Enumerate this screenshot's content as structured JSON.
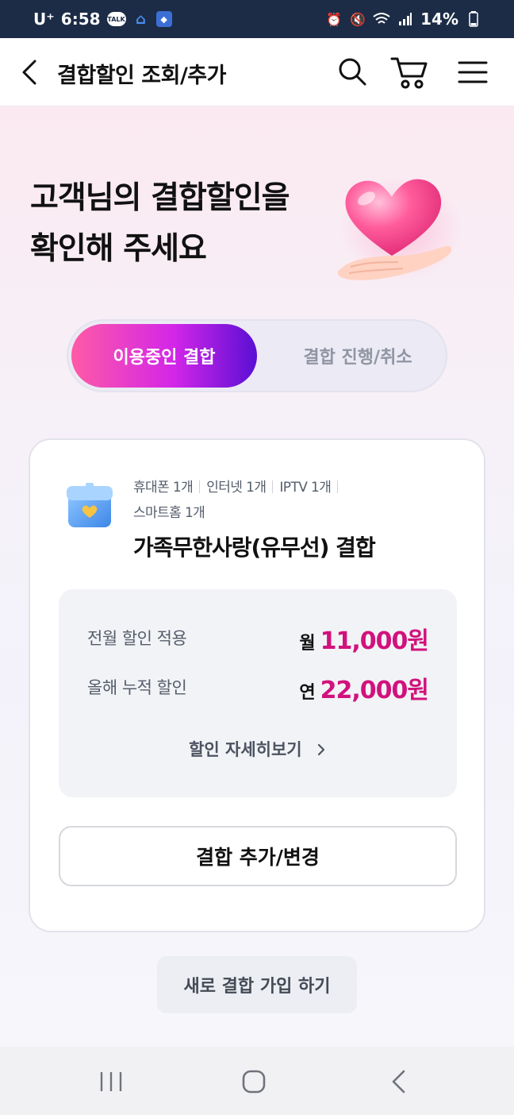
{
  "status_bar": {
    "carrier": "U⁺",
    "time": "6:58",
    "icons": [
      "kakaotalk-icon",
      "home-icon",
      "app-icon",
      "alarm-icon",
      "mute-icon",
      "wifi-icon",
      "signal-icon",
      "battery-icon"
    ],
    "battery": "14%",
    "talk_label": "TALK"
  },
  "header": {
    "title": "결합할인 조회/추가",
    "icons": [
      "back-icon",
      "search-icon",
      "cart-icon",
      "menu-icon"
    ]
  },
  "hero": {
    "line1": "고객님의 결합할인을",
    "line2": "확인해 주세요",
    "image": "heart-hand-icon"
  },
  "tabs": {
    "active": "이용중인 결합",
    "inactive": "결합 진행/취소"
  },
  "card": {
    "icon": "bundle-box-icon",
    "services": [
      "휴대폰 1개",
      "인터넷 1개",
      "IPTV 1개",
      "스마트홈 1개"
    ],
    "bundle_name": "가족무한사랑(유무선) 결합",
    "discounts": [
      {
        "label": "전월 할인 적용",
        "unit": "월",
        "amount": "11,000원"
      },
      {
        "label": "올해 누적 할인",
        "unit": "연",
        "amount": "22,000원"
      }
    ],
    "detail_link": "할인 자세히보기",
    "change_button": "결합 추가/변경"
  },
  "new_button": "새로 결합 가입 하기",
  "colors": {
    "accent": "#d1127c",
    "tab_gradient_start": "#ff5aa6",
    "tab_gradient_end": "#5a0fd4",
    "status_bar": "#1c2c46"
  }
}
